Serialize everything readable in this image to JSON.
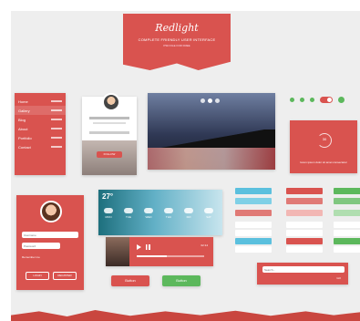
{
  "header": {
    "logo": "Redlight",
    "title": "COMPLETE FRIENDLY USER INTERFACE",
    "subtitle": "PSD FILE FOR FREE"
  },
  "colors": {
    "accent": "#d9534f",
    "green": "#5cb85c",
    "blue": "#5bc0de",
    "bg": "#eeeeee"
  },
  "menu": {
    "items": [
      "Home",
      "Gallery",
      "Blog",
      "About",
      "Portfolio",
      "Contact"
    ]
  },
  "profile_card": {
    "button_text": "FOLLOW"
  },
  "photo_slider": {
    "dots": 3
  },
  "timer": {
    "value": "30",
    "caption": "lorem ipsum dolor sit amet consectetur"
  },
  "weather": {
    "temp": "27°",
    "days": [
      "MON",
      "TUE",
      "WED",
      "THU",
      "FRI",
      "SAT"
    ]
  },
  "login": {
    "username_placeholder": "Username",
    "password_placeholder": "Password",
    "remember": "Remember me",
    "login_label": "LOGIN",
    "register_label": "REGISTER"
  },
  "player": {
    "time": "02:14"
  },
  "buttons": {
    "red_label": "Button",
    "green_label": "Button"
  },
  "search": {
    "placeholder": "Search...",
    "button": "GO"
  }
}
